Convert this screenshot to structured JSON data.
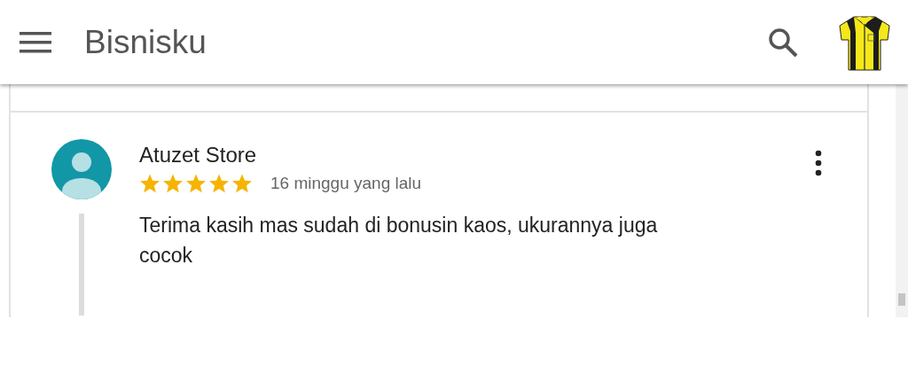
{
  "app_bar": {
    "title": "Bisnisku"
  },
  "review": {
    "author": "Atuzet Store",
    "stars": 5,
    "time": "16 minggu yang lalu",
    "text": "Terima kasih mas sudah di bonusin kaos, ukurannya juga cocok"
  }
}
